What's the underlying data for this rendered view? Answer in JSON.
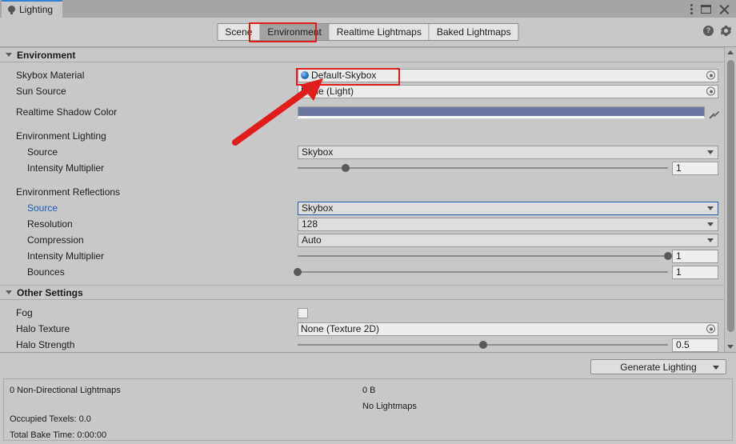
{
  "window": {
    "tab_label": "Lighting",
    "tab_icon": "lightbulb-icon",
    "controls": {
      "menu": "kebab-menu-icon",
      "maximize": "maximize-icon",
      "close": "close-icon"
    }
  },
  "toolbar": {
    "tabs": [
      {
        "label": "Scene",
        "selected": false
      },
      {
        "label": "Environment",
        "selected": true
      },
      {
        "label": "Realtime Lightmaps",
        "selected": false
      },
      {
        "label": "Baked Lightmaps",
        "selected": false
      }
    ],
    "help_icon": "help-icon",
    "help_glyph": "?",
    "settings_icon": "gear-icon"
  },
  "environment_section": {
    "header": "Environment",
    "skybox_material": {
      "label": "Skybox Material",
      "value": "Default-Skybox",
      "icon": "material-sphere-icon",
      "highlighted": true
    },
    "sun_source": {
      "label": "Sun Source",
      "value": "None (Light)"
    },
    "realtime_shadow_color": {
      "label": "Realtime Shadow Color",
      "color": "#6b779e"
    },
    "environment_lighting": {
      "label": "Environment Lighting",
      "source": {
        "label": "Source",
        "value": "Skybox"
      },
      "intensity_multiplier": {
        "label": "Intensity Multiplier",
        "value": "1",
        "slider_pct": 13
      }
    },
    "environment_reflections": {
      "label": "Environment Reflections",
      "source": {
        "label": "Source",
        "value": "Skybox",
        "label_color": "#1f5bb6",
        "focused": true
      },
      "resolution": {
        "label": "Resolution",
        "value": "128"
      },
      "compression": {
        "label": "Compression",
        "value": "Auto"
      },
      "intensity_multiplier": {
        "label": "Intensity Multiplier",
        "value": "1",
        "slider_pct": 100
      },
      "bounces": {
        "label": "Bounces",
        "value": "1",
        "slider_pct": 0
      }
    }
  },
  "other_settings_section": {
    "header": "Other Settings",
    "fog": {
      "label": "Fog",
      "checked": false
    },
    "halo_texture": {
      "label": "Halo Texture",
      "value": "None (Texture 2D)"
    },
    "halo_strength": {
      "label": "Halo Strength",
      "value": "0.5",
      "slider_pct": 50
    }
  },
  "footer": {
    "generate_button": "Generate Lighting",
    "stats_left": [
      "0 Non-Directional Lightmaps",
      "Occupied Texels: 0.0",
      "Total Bake Time: 0:00:00"
    ],
    "stats_right": [
      "0 B",
      "No Lightmaps"
    ]
  },
  "annotations": {
    "highlight_color": "#e01c1c",
    "arrow_color": "#e01c1c"
  }
}
